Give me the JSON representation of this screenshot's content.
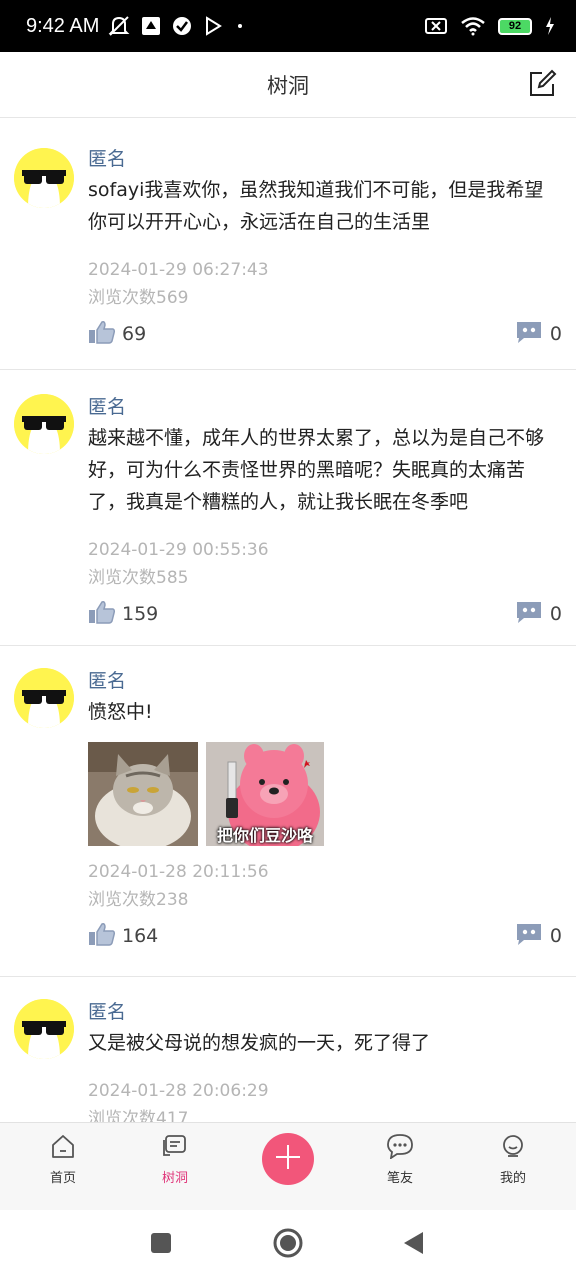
{
  "status_bar": {
    "time": "9:42 AM",
    "battery": "92",
    "icons": [
      "mute-icon",
      "app-icon",
      "check-circle-icon",
      "play-icon",
      "dot-icon",
      "sim-off-icon",
      "wifi-icon",
      "battery-icon",
      "charging-icon"
    ]
  },
  "header": {
    "title": "树洞",
    "edit_icon": "edit-icon"
  },
  "posts": [
    {
      "author": "匿名",
      "content": "sofayi我喜欢你，虽然我知道我们不可能，但是我希望你可以开开心心，永远活在自己的生活里",
      "time": "2024-01-29 06:27:43",
      "views": "浏览次数569",
      "likes": "69",
      "comments": "0"
    },
    {
      "author": "匿名",
      "content": "越来越不懂，成年人的世界太累了，总以为是自己不够好，可为什么不责怪世界的黑暗呢？失眠真的太痛苦了，我真是个糟糕的人，就让我长眠在冬季吧",
      "time": "2024-01-29 00:55:36",
      "views": "浏览次数585",
      "likes": "159",
      "comments": "0"
    },
    {
      "author": "匿名",
      "content": "愤怒中!",
      "images": [
        {
          "alt": "grumpy-cat-image"
        },
        {
          "alt": "pink-plush-knife-image",
          "caption": "把你们豆沙咯"
        }
      ],
      "time": "2024-01-28 20:11:56",
      "views": "浏览次数238",
      "likes": "164",
      "comments": "0"
    },
    {
      "author": "匿名",
      "content": "又是被父母说的想发疯的一天，死了得了",
      "time": "2024-01-28 20:06:29",
      "views": "浏览次数417",
      "likes": "",
      "comments": ""
    }
  ],
  "tabbar": {
    "tabs": [
      {
        "label": "首页",
        "icon": "home-icon",
        "active": false
      },
      {
        "label": "树洞",
        "icon": "message-board-icon",
        "active": true
      },
      {
        "label": "笔友",
        "icon": "chat-bubble-icon",
        "active": false
      },
      {
        "label": "我的",
        "icon": "profile-icon",
        "active": false
      }
    ],
    "fab_icon": "plus-icon"
  },
  "colors": {
    "accent": "#e0377b",
    "fab": "#f2567a",
    "author": "#4a6a92",
    "meta": "#b5b5b5"
  }
}
